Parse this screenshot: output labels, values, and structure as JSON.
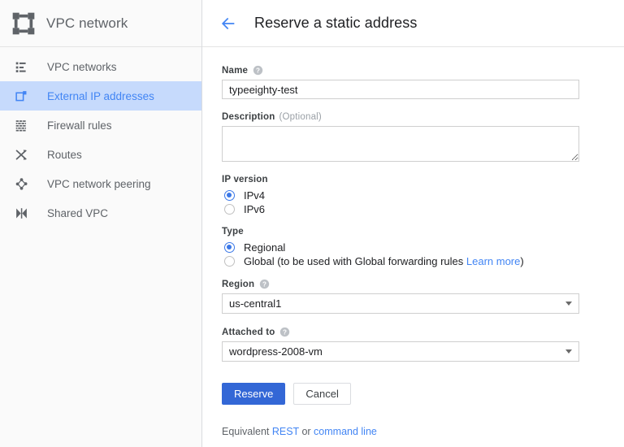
{
  "sidebar": {
    "logo_icon": "vpc-network-logo-icon",
    "title": "VPC network",
    "items": [
      {
        "label": "VPC networks",
        "icon": "network-list-icon",
        "active": false
      },
      {
        "label": "External IP addresses",
        "icon": "external-ip-icon",
        "active": true
      },
      {
        "label": "Firewall rules",
        "icon": "firewall-icon",
        "active": false
      },
      {
        "label": "Routes",
        "icon": "routes-shuffle-icon",
        "active": false
      },
      {
        "label": "VPC network peering",
        "icon": "peering-icon",
        "active": false
      },
      {
        "label": "Shared VPC",
        "icon": "shared-vpc-icon",
        "active": false
      }
    ]
  },
  "header": {
    "back_icon": "back-arrow-icon",
    "title": "Reserve a static address"
  },
  "form": {
    "name": {
      "label": "Name",
      "help_icon": "help-circle-icon",
      "value": "typeeighty-test",
      "placeholder": ""
    },
    "description": {
      "label": "Description",
      "optional_text": "(Optional)",
      "value": "",
      "placeholder": ""
    },
    "ip_version": {
      "label": "IP version",
      "options": [
        {
          "label": "IPv4",
          "checked": true
        },
        {
          "label": "IPv6",
          "checked": false
        }
      ]
    },
    "type": {
      "label": "Type",
      "options": [
        {
          "label": "Regional",
          "checked": true,
          "suffix": "",
          "link": "",
          "tail": ""
        },
        {
          "label": "Global (to be used with Global forwarding rules ",
          "checked": false,
          "link": "Learn more",
          "tail": ")"
        }
      ]
    },
    "region": {
      "label": "Region",
      "help_icon": "help-circle-icon",
      "value": "us-central1"
    },
    "attached_to": {
      "label": "Attached to",
      "help_icon": "help-circle-icon",
      "value": "wordpress-2008-vm"
    }
  },
  "actions": {
    "primary_label": "Reserve",
    "secondary_label": "Cancel"
  },
  "footer": {
    "prefix": "Equivalent ",
    "rest_link": "REST",
    "separator": " or ",
    "cli_link": "command line"
  },
  "colors": {
    "accent_blue": "#4285f4",
    "primary_button": "#3367d6",
    "active_nav_bg": "#c6dafc",
    "sidebar_bg": "#fafafa",
    "text_primary": "#202124",
    "text_secondary": "#5f6368"
  }
}
